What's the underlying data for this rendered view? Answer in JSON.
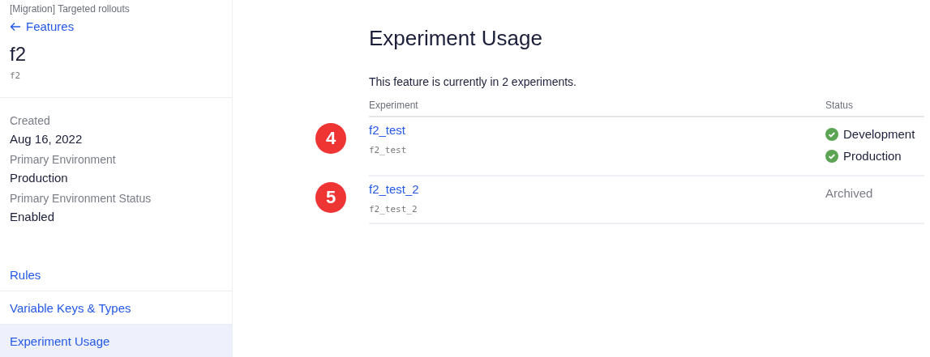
{
  "sidebar": {
    "breadcrumb": "[Migration] Targeted rollouts",
    "back_link": "Features",
    "feature_name": "f2",
    "feature_key": "f2",
    "details": [
      {
        "label": "Created",
        "value": "Aug 16, 2022"
      },
      {
        "label": "Primary Environment",
        "value": "Production"
      },
      {
        "label": "Primary Environment Status",
        "value": "Enabled"
      }
    ],
    "nav": [
      {
        "label": "Rules",
        "selected": false
      },
      {
        "label": "Variable Keys & Types",
        "selected": false
      },
      {
        "label": "Experiment Usage",
        "selected": true
      }
    ]
  },
  "main": {
    "title": "Experiment Usage",
    "summary": "This feature is currently in 2 experiments.",
    "table": {
      "columns": [
        "Experiment",
        "Status"
      ],
      "rows": [
        {
          "marker": "4",
          "name": "f2_test",
          "key": "f2_test",
          "statuses": [
            {
              "kind": "active",
              "label": "Development"
            },
            {
              "kind": "active",
              "label": "Production"
            }
          ]
        },
        {
          "marker": "5",
          "name": "f2_test_2",
          "key": "f2_test_2",
          "statuses": [
            {
              "kind": "archived",
              "label": "Archived"
            }
          ]
        }
      ]
    }
  }
}
